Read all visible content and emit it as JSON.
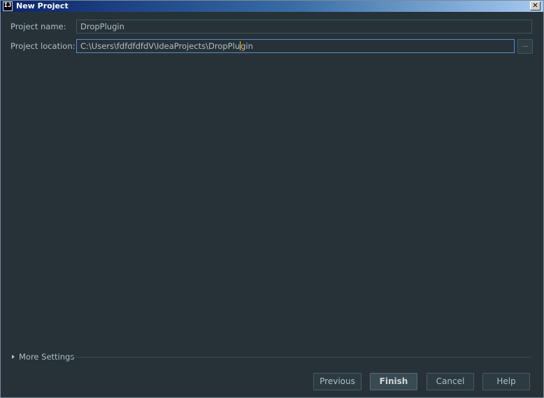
{
  "window": {
    "title": "New Project",
    "app_icon_text": "IJ",
    "close_label": "✕"
  },
  "form": {
    "project_name_label": "Project name:",
    "project_name_value": "DropPlugin",
    "project_location_label": "Project location:",
    "project_location_value_before_caret": "C:\\Users\\fdfdfdfdV\\IdeaProjects\\DropPlu",
    "project_location_value_after_caret": "gin",
    "browse_label": "..."
  },
  "more_settings": {
    "label": "More Settings"
  },
  "buttons": {
    "previous": "Previous",
    "finish": "Finish",
    "cancel": "Cancel",
    "help": "Help"
  },
  "colors": {
    "background": "#263238",
    "text": "#b0bec5",
    "focus_border": "#5f8dbb",
    "caret": "#f5c342"
  }
}
